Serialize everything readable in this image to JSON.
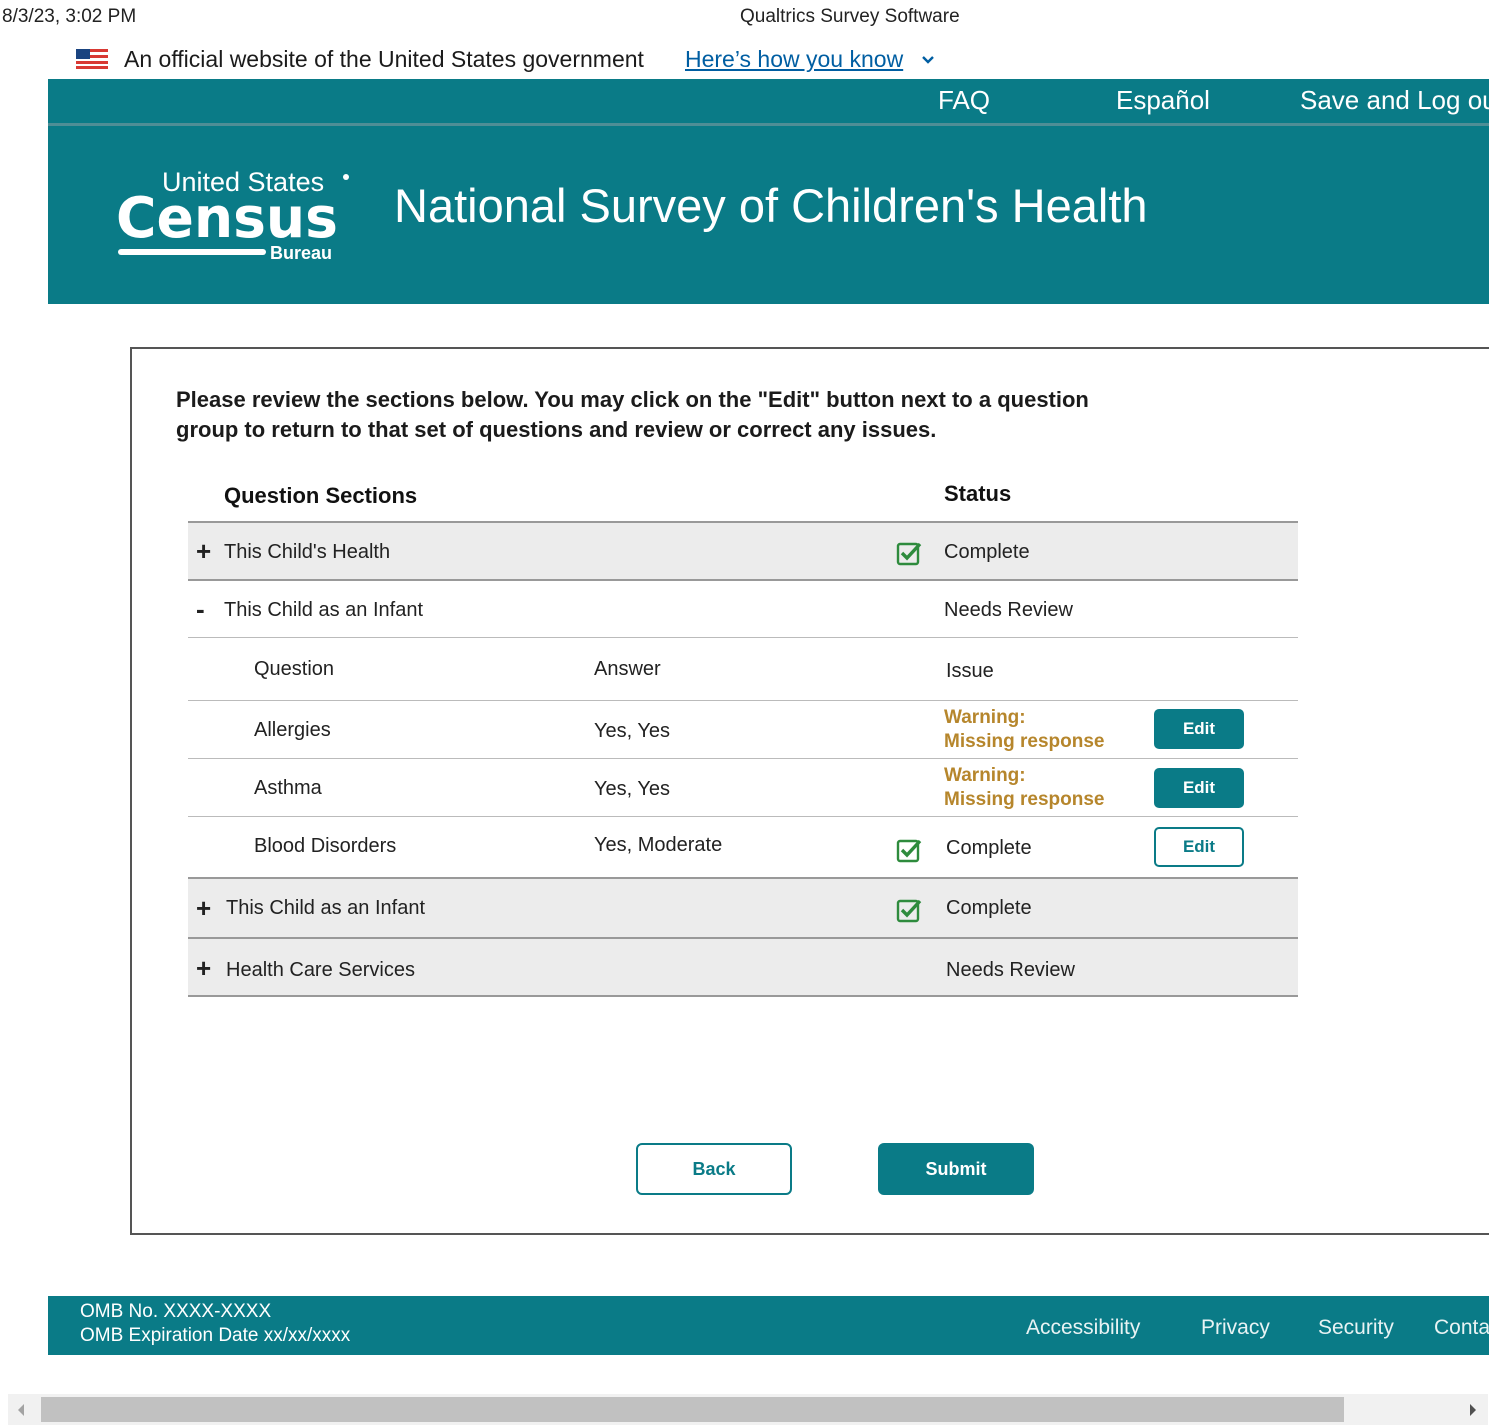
{
  "print_header": {
    "date": "8/3/23, 3:02 PM",
    "title": "Qualtrics Survey Software"
  },
  "gov_banner": {
    "text": "An official website of the United States government",
    "link": "Here’s how you know"
  },
  "top_nav": {
    "faq": "FAQ",
    "espanol": "Español",
    "save_logout": "Save and Log ou"
  },
  "masthead": {
    "logo": {
      "united_states": "United States",
      "census": "Census",
      "bureau": "Bureau"
    },
    "title": "National Survey of Children's Health"
  },
  "main": {
    "instructions_line1": "Please review the sections below. You may click on the \"Edit\" button next to a question",
    "instructions_line2": "group to return to that set of questions and review or correct any issues.",
    "table": {
      "header_sections": "Question Sections",
      "header_status": "Status",
      "sections": [
        {
          "toggle": "+",
          "name": "This Child's Health",
          "status": "Complete"
        },
        {
          "toggle": "-",
          "name": "This Child as an Infant",
          "status": "Needs Review"
        },
        {
          "toggle": "+",
          "name": "This Child as an Infant",
          "status": "Complete"
        },
        {
          "toggle": "+",
          "name": "Health Care Services",
          "status": "Needs Review"
        }
      ],
      "sub_headers": {
        "question": "Question",
        "answer": "Answer",
        "issue": "Issue"
      },
      "sub_rows": [
        {
          "question": "Allergies",
          "answer": "Yes, Yes",
          "issue_line1": "Warning:",
          "issue_line2": "Missing response",
          "edit": "Edit"
        },
        {
          "question": "Asthma",
          "answer": "Yes, Yes",
          "issue_line1": "Warning:",
          "issue_line2": "Missing response",
          "edit": "Edit"
        },
        {
          "question": "Blood Disorders",
          "answer": "Yes, Moderate",
          "issue": "Complete",
          "edit": "Edit"
        }
      ]
    },
    "back": "Back",
    "submit": "Submit"
  },
  "footer": {
    "omb_no": "OMB No. XXXX-XXXX",
    "omb_exp": "OMB Expiration Date xx/xx/xxxx",
    "links": {
      "accessibility": "Accessibility",
      "privacy": "Privacy",
      "security": "Security",
      "contact": "Conta"
    }
  },
  "colors": {
    "brand_teal": "#0a7b87",
    "warning": "#b6862c",
    "check_green": "#2e8b3d"
  },
  "icons": {
    "flag": "us-flag-icon",
    "chevron": "chevron-down-icon",
    "check": "checkbox-checked-icon"
  }
}
